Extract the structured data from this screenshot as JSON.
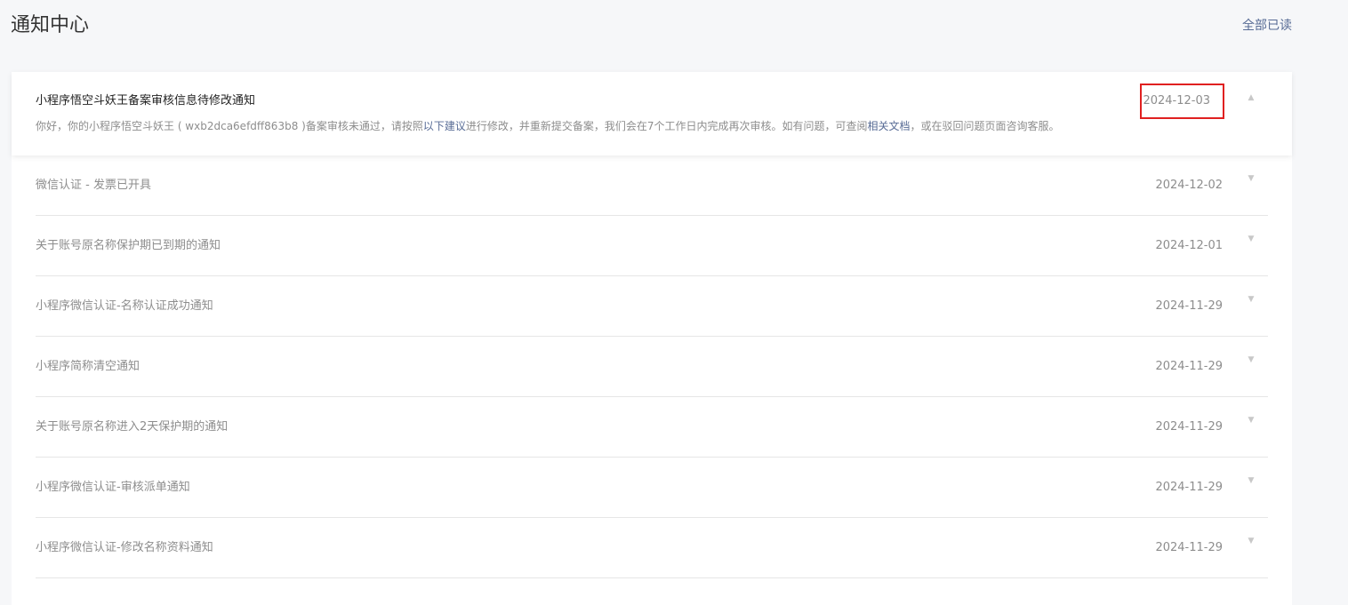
{
  "header": {
    "title": "通知中心",
    "mark_all_read": "全部已读"
  },
  "expanded_notice": {
    "title": "小程序悟空斗妖王备案审核信息待修改通知",
    "date": "2024-12-03",
    "body_part1": "你好，你的小程序悟空斗妖王 ( wxb2dca6efdff863b8 )备案审核未通过，请按照",
    "link1": "以下建议",
    "body_part2": "进行修改，并重新提交备案，我们会在7个工作日内完成再次审核。如有问题，可查阅",
    "link2": "相关文档",
    "body_part3": "，或在驳回问题页面咨询客服。"
  },
  "notices": [
    {
      "title": "微信认证 - 发票已开具",
      "date": "2024-12-02"
    },
    {
      "title": "关于账号原名称保护期已到期的通知",
      "date": "2024-12-01"
    },
    {
      "title": "小程序微信认证-名称认证成功通知",
      "date": "2024-11-29"
    },
    {
      "title": "小程序简称清空通知",
      "date": "2024-11-29"
    },
    {
      "title": "关于账号原名称进入2天保护期的通知",
      "date": "2024-11-29"
    },
    {
      "title": "小程序微信认证-审核派单通知",
      "date": "2024-11-29"
    },
    {
      "title": "小程序微信认证-修改名称资料通知",
      "date": "2024-11-29"
    }
  ],
  "icons": {
    "expand": "chevron-up-icon",
    "collapse": "chevron-down-icon"
  }
}
